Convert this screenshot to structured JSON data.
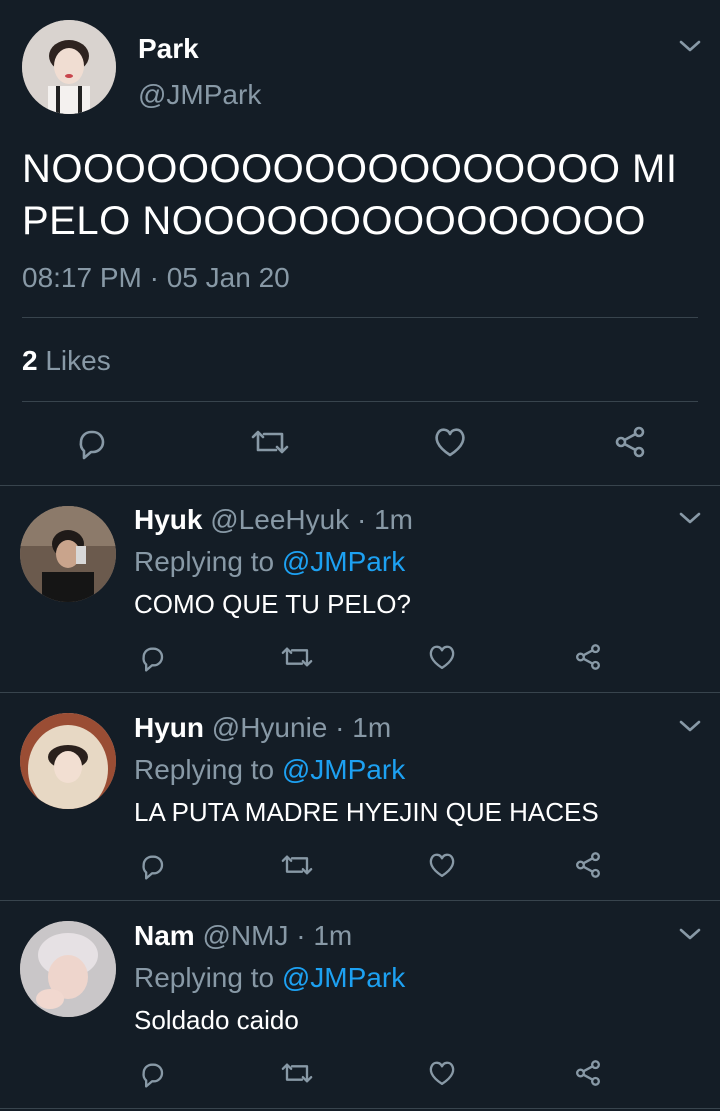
{
  "main_tweet": {
    "name": "Park",
    "handle": "@JMPark",
    "text_line1": "NOOOOOOOOOOOOOOOOOO MI",
    "text_line2": "PELO NOOOOOOOOOOOOOOO",
    "timestamp": "08:17 PM · 05 Jan 20",
    "likes_count": "2",
    "likes_label": "Likes"
  },
  "replies": [
    {
      "name": "Hyuk",
      "handle": "@LeeHyuk",
      "time": "· 1m",
      "replying_label": "Replying to",
      "replying_handle": "@JMPark",
      "text": "COMO QUE TU PELO?"
    },
    {
      "name": "Hyun",
      "handle": "@Hyunie",
      "time": "· 1m",
      "replying_label": "Replying to",
      "replying_handle": "@JMPark",
      "text": "LA PUTA MADRE HYEJIN QUE HACES"
    },
    {
      "name": "Nam",
      "handle": "@NMJ",
      "time": "· 1m",
      "replying_label": "Replying to",
      "replying_handle": "@JMPark",
      "text": "Soldado caido"
    }
  ],
  "colors": {
    "background": "#141d26",
    "muted": "#8899a6",
    "link": "#1da1f2",
    "divider": "#38444d"
  },
  "icons": [
    "chevron-down-icon",
    "reply-icon",
    "retweet-icon",
    "like-icon",
    "share-icon"
  ]
}
